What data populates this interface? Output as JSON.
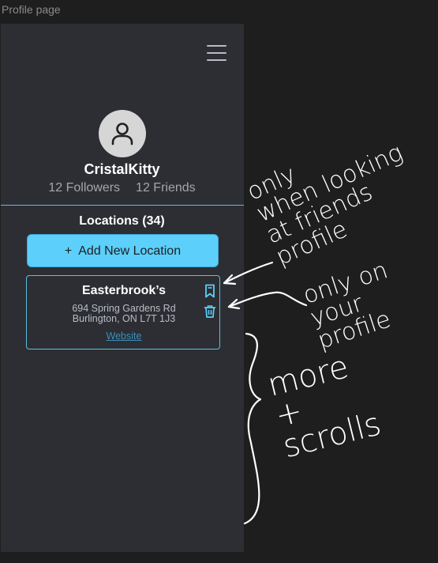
{
  "frame": {
    "label": "Profile page"
  },
  "header": {
    "menu_icon": "hamburger-menu-icon"
  },
  "profile": {
    "avatar_icon": "user-icon",
    "username": "CristalKitty",
    "followers": "12 Followers",
    "friends": "12 Friends"
  },
  "locations": {
    "title": "Locations (34)",
    "add_button": "+  Add New Location",
    "items": [
      {
        "name": "Easterbrook’s",
        "address_line1": "694 Spring Gardens Rd",
        "address_line2": "Burlington, ON L7T 1J3",
        "link": "Website",
        "icons": [
          "bookmark-icon",
          "trash-icon"
        ]
      }
    ]
  },
  "annotations": {
    "note1": "only\nwhen looking\nat friends\nprofile",
    "note2": "only on\nyour\nprofile",
    "note3": "more\n+\nscrolls"
  },
  "colors": {
    "background": "#1e1e1e",
    "panel": "#2c2e33",
    "accent": "#5ccffa",
    "border": "#5fbfe0",
    "link": "#3d8fb8"
  }
}
